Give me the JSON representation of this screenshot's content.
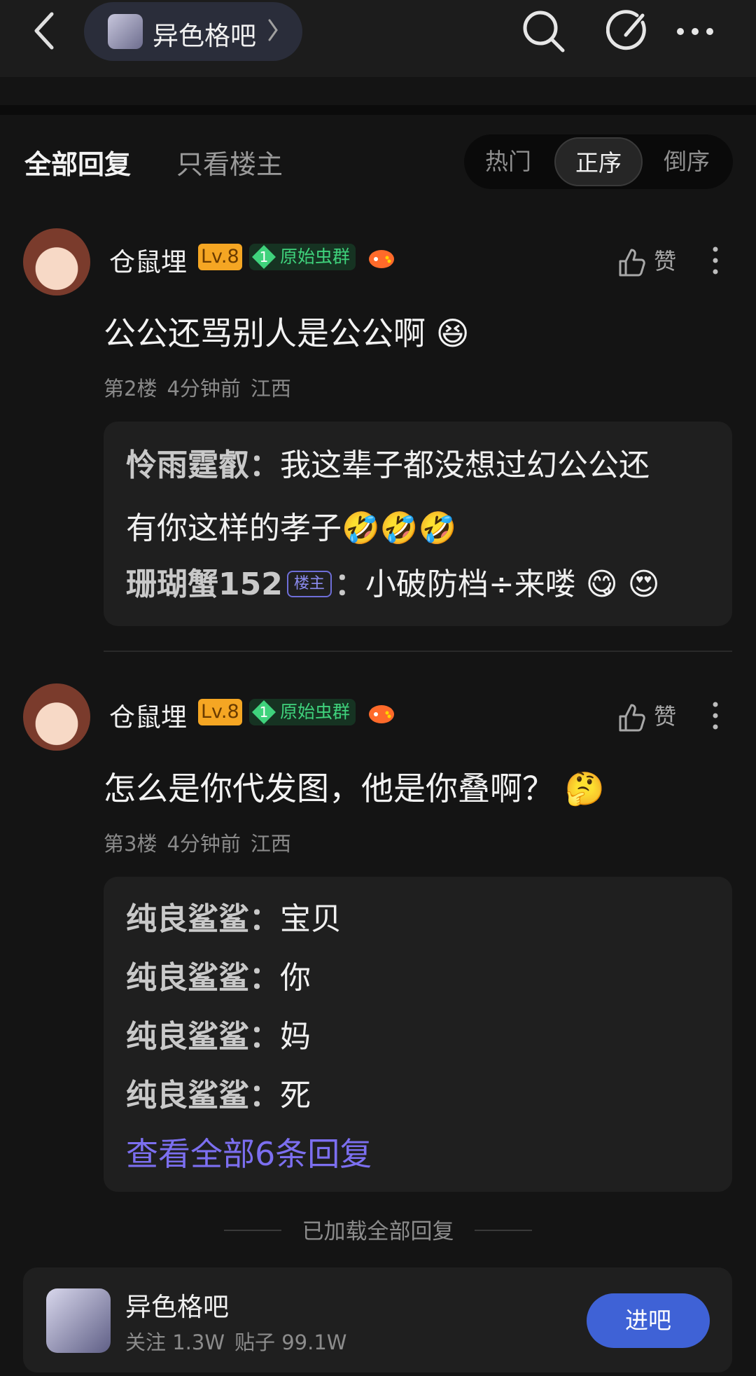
{
  "header": {
    "forum_name": "异色格吧",
    "back_icon": "chevron-left-icon",
    "search_icon": "search-icon",
    "compose_icon": "compose-icon",
    "more_icon": "more-horizontal-icon"
  },
  "tabs": {
    "all_replies": "全部回复",
    "op_only": "只看楼主",
    "sort": [
      "热门",
      "正序",
      "倒序"
    ],
    "sort_active": "正序"
  },
  "posts": [
    {
      "username": "仓鼠埋",
      "level": "Lv.8",
      "group_rank": "1",
      "group": "原始虫群",
      "like_label": "赞",
      "content": "公公还骂别人是公公啊",
      "content_emoji": "😆",
      "floor": "第2楼",
      "time": "4分钟前",
      "location": "江西",
      "replies": [
        {
          "who": "怜雨霆叡",
          "sep": "：",
          "text_line1": "我这辈子都没想过幻公公还",
          "text_line2": "有你这样的孝子🤣🤣🤣"
        },
        {
          "who": "珊瑚蟹152",
          "badge": "楼主",
          "sep": "：",
          "text": "小破防档÷来喽 😋 😍"
        }
      ]
    },
    {
      "username": "仓鼠埋",
      "level": "Lv.8",
      "group_rank": "1",
      "group": "原始虫群",
      "like_label": "赞",
      "content": "怎么是你代发图，他是你叠啊？",
      "content_emoji": "🤔",
      "floor": "第3楼",
      "time": "4分钟前",
      "location": "江西",
      "replies": [
        {
          "who": "纯良鲨鲨",
          "sep": "：",
          "text": "宝贝"
        },
        {
          "who": "纯良鲨鲨",
          "sep": "：",
          "text": "你"
        },
        {
          "who": "纯良鲨鲨",
          "sep": "：",
          "text": "妈"
        },
        {
          "who": "纯良鲨鲨",
          "sep": "：",
          "text": "死"
        }
      ],
      "view_all": "查看全部6条回复"
    }
  ],
  "footer": {
    "loaded_text": "已加载全部回复",
    "forum_name": "异色格吧",
    "followers_label": "关注 1.3W",
    "posts_label": "贴子 99.1W",
    "enter_label": "进吧",
    "enter_color": "#3f62d6"
  },
  "colors": {
    "background": "#141414",
    "level_badge": "#f5a623",
    "group_badge_text": "#3fd27c",
    "link": "#7c6ff0"
  }
}
